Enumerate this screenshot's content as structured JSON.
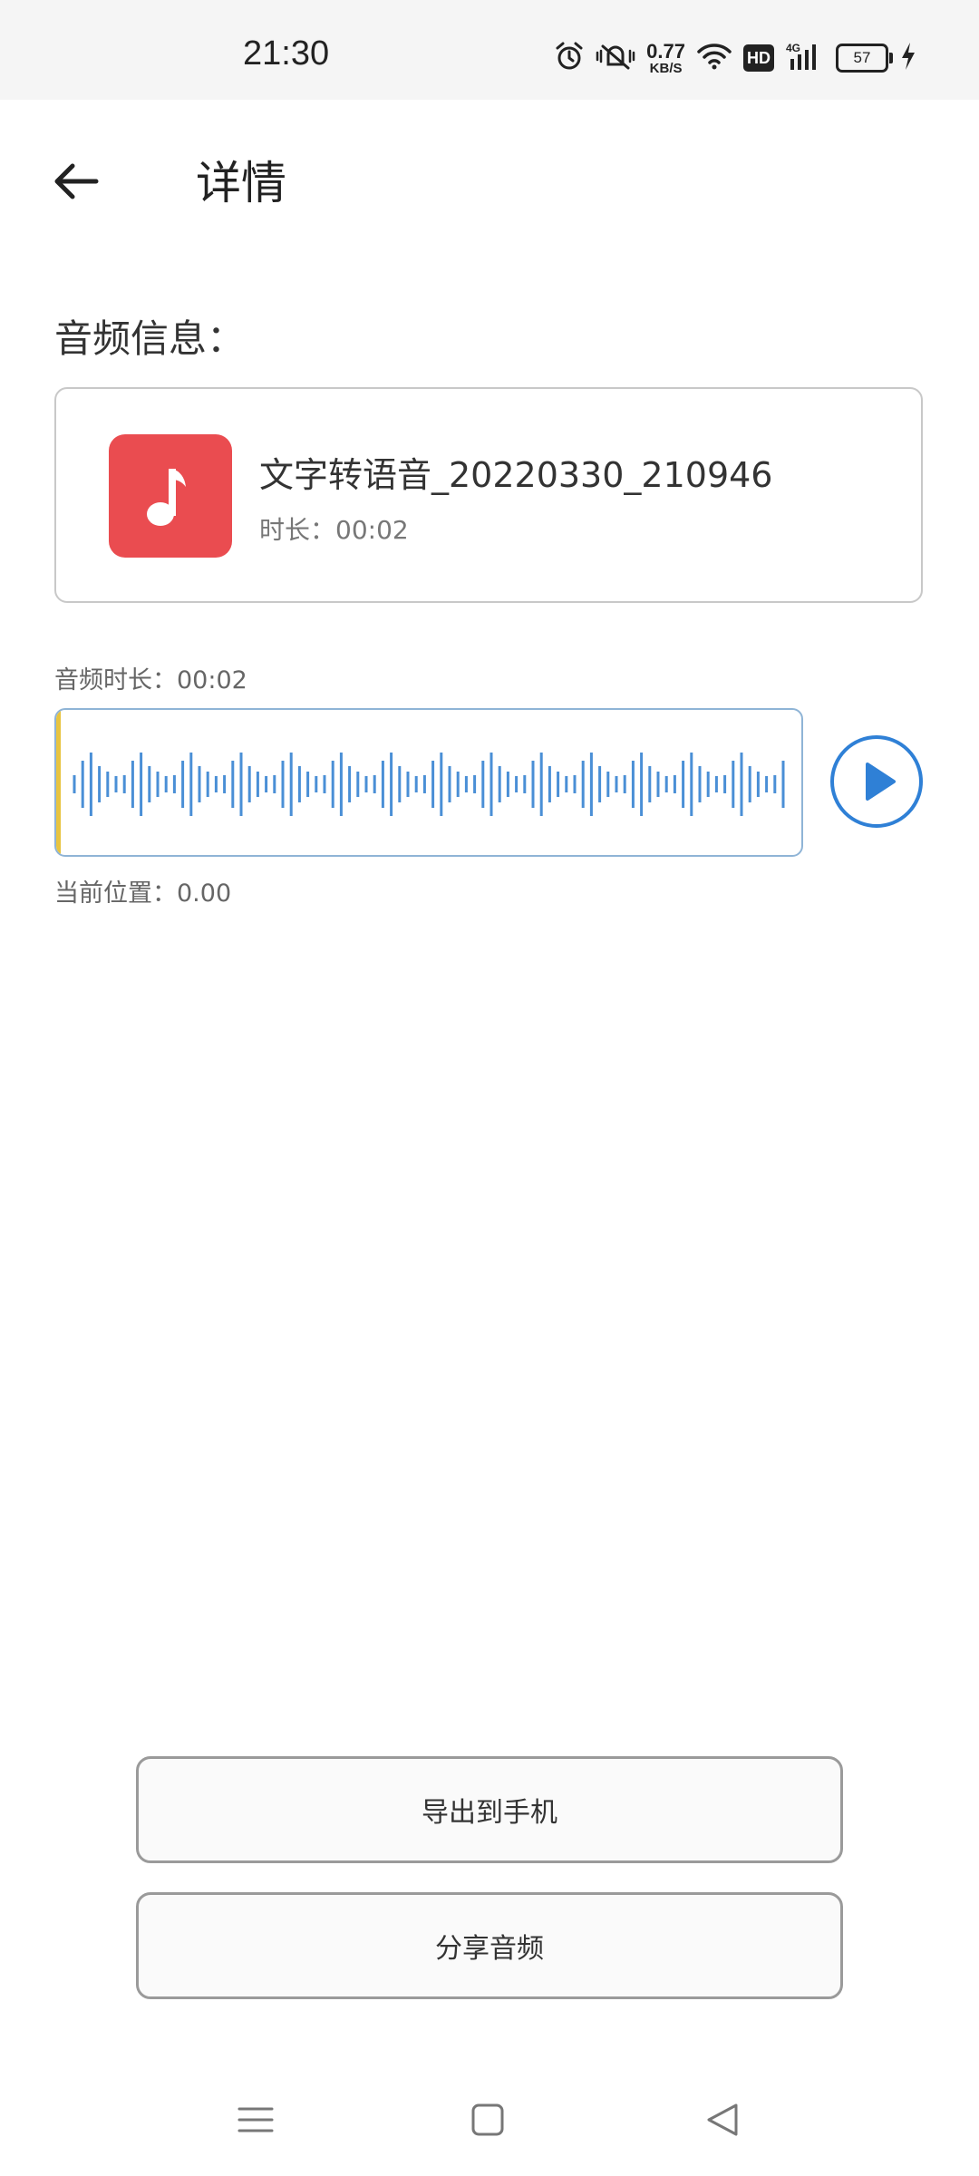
{
  "status_bar": {
    "time": "21:30",
    "net_speed_value": "0.77",
    "net_speed_unit": "KB/S",
    "hd": "HD",
    "network": "4G",
    "battery": "57",
    "icons": [
      "alarm-icon",
      "mute-icon",
      "wifi-icon",
      "signal-icon",
      "charging-icon"
    ]
  },
  "header": {
    "title": "详情",
    "back_icon": "arrow-left-icon"
  },
  "audio_info": {
    "section_title": "音频信息：",
    "file_name": "文字转语音_20220330_210946",
    "duration_label": "时长：",
    "duration_value": "00:02",
    "icon": "music-note-icon",
    "icon_color": "#ea4c50"
  },
  "player": {
    "audio_duration_label": "音频时长：",
    "audio_duration_value": "00:02",
    "current_position_label": "当前位置：",
    "current_position_value": "0.00",
    "waveform_color": "#4a8fd6",
    "playhead_color": "#e8c440",
    "play_icon": "play-circle-icon"
  },
  "actions": {
    "export_label": "导出到手机",
    "share_label": "分享音频"
  },
  "nav_bar": {
    "icons": [
      "menu-icon",
      "home-square-icon",
      "back-triangle-icon"
    ]
  }
}
